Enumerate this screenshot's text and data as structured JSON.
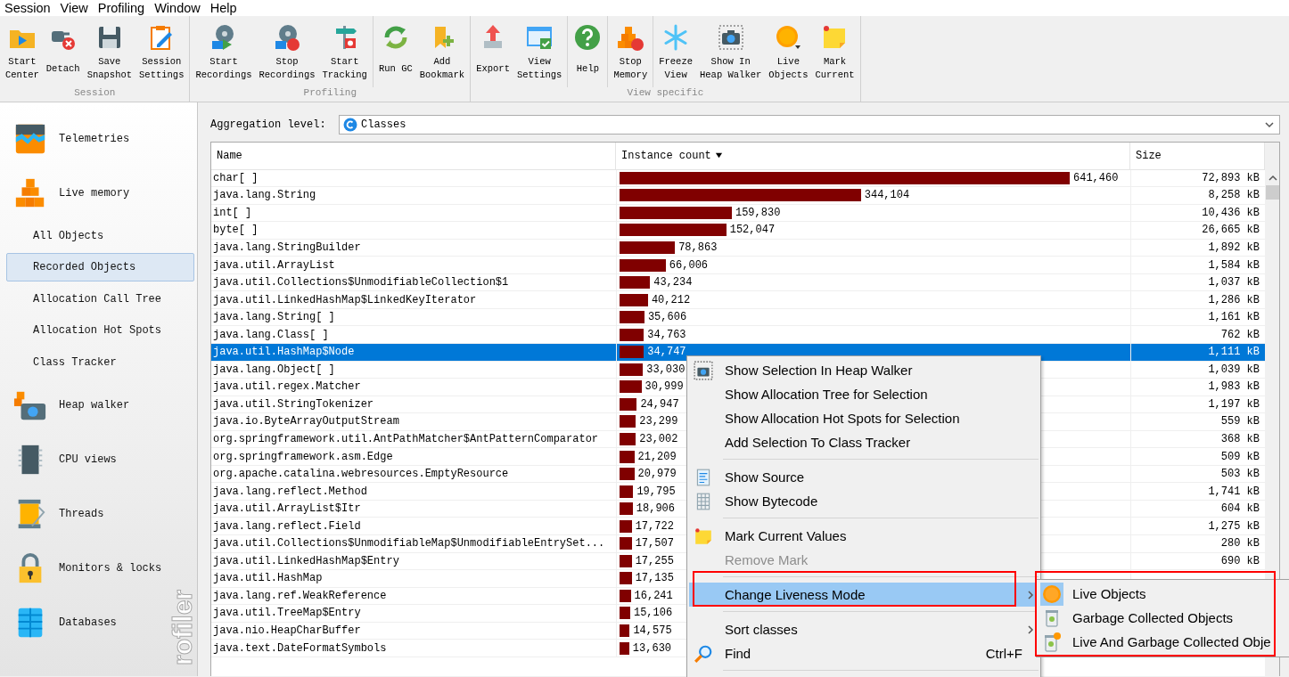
{
  "menubar": [
    "Session",
    "View",
    "Profiling",
    "Window",
    "Help"
  ],
  "toolbar": [
    {
      "label": "Session",
      "sections": [
        [
          "Start\nCenter",
          "Detach",
          "Save\nSnapshot",
          "Session\nSettings"
        ]
      ]
    },
    {
      "label": "Profiling",
      "sections": [
        [
          "Start\nRecordings",
          "Stop\nRecordings",
          "Start\nTracking"
        ],
        [
          "Run GC",
          "Add\nBookmark"
        ]
      ]
    },
    {
      "label": "View specific",
      "sections": [
        [
          "Export",
          "View\nSettings"
        ],
        [
          "Help"
        ],
        [
          "Stop\nMemory"
        ],
        [
          "Freeze\nView",
          "Show In\nHeap Walker",
          "Live\nObjects",
          "Mark\nCurrent"
        ]
      ]
    }
  ],
  "sidebar": {
    "watermark": "rofiler",
    "items": [
      {
        "label": "Telemetries",
        "selected": false
      },
      {
        "label": "Live memory",
        "selected": false,
        "children": [
          {
            "label": "All Objects",
            "selected": false
          },
          {
            "label": "Recorded Objects",
            "selected": true
          },
          {
            "label": "Allocation Call Tree",
            "selected": false
          },
          {
            "label": "Allocation Hot Spots",
            "selected": false
          },
          {
            "label": "Class Tracker",
            "selected": false
          }
        ]
      },
      {
        "label": "Heap walker",
        "selected": false
      },
      {
        "label": "CPU views",
        "selected": false
      },
      {
        "label": "Threads",
        "selected": false
      },
      {
        "label": "Monitors & locks",
        "selected": false
      },
      {
        "label": "Databases",
        "selected": false
      }
    ]
  },
  "aggregation": {
    "label": "Aggregation level:",
    "value": "Classes"
  },
  "table": {
    "columns": [
      {
        "label": "Name",
        "sorted": false
      },
      {
        "label": "Instance count",
        "sorted": true
      },
      {
        "label": "Size",
        "sorted": false
      }
    ],
    "rows": [
      {
        "name": "char[ ]",
        "count": "641,460",
        "level": 0.886,
        "size": "72,893 kB",
        "selected": false
      },
      {
        "name": "java.lang.String",
        "count": "344,104",
        "level": 0.475,
        "size": "8,258 kB",
        "selected": false
      },
      {
        "name": "int[ ]",
        "count": "159,830",
        "level": 0.221,
        "size": "10,436 kB",
        "selected": false
      },
      {
        "name": "byte[ ]",
        "count": "152,047",
        "level": 0.21,
        "size": "26,665 kB",
        "selected": false
      },
      {
        "name": "java.lang.StringBuilder",
        "count": "78,863",
        "level": 0.109,
        "size": "1,892 kB",
        "selected": false
      },
      {
        "name": "java.util.ArrayList",
        "count": "66,006",
        "level": 0.091,
        "size": "1,584 kB",
        "selected": false
      },
      {
        "name": "java.util.Collections$UnmodifiableCollection$1",
        "count": "43,234",
        "level": 0.06,
        "size": "1,037 kB",
        "selected": false
      },
      {
        "name": "java.util.LinkedHashMap$LinkedKeyIterator",
        "count": "40,212",
        "level": 0.056,
        "size": "1,286 kB",
        "selected": false
      },
      {
        "name": "java.lang.String[ ]",
        "count": "35,606",
        "level": 0.049,
        "size": "1,161 kB",
        "selected": false
      },
      {
        "name": "java.lang.Class[ ]",
        "count": "34,763",
        "level": 0.048,
        "size": "762 kB",
        "selected": false
      },
      {
        "name": "java.util.HashMap$Node",
        "count": "34,747",
        "level": 0.048,
        "size": "1,111 kB",
        "selected": true
      },
      {
        "name": "java.lang.Object[ ]",
        "count": "33,030",
        "level": 0.046,
        "size": "1,039 kB",
        "selected": false
      },
      {
        "name": "java.util.regex.Matcher",
        "count": "30,999",
        "level": 0.043,
        "size": "1,983 kB",
        "selected": false
      },
      {
        "name": "java.util.StringTokenizer",
        "count": "24,947",
        "level": 0.034,
        "size": "1,197 kB",
        "selected": false
      },
      {
        "name": "java.io.ByteArrayOutputStream",
        "count": "23,299",
        "level": 0.032,
        "size": "559 kB",
        "selected": false
      },
      {
        "name": "org.springframework.util.AntPathMatcher$AntPatternComparator",
        "count": "23,002",
        "level": 0.032,
        "size": "368 kB",
        "selected": false
      },
      {
        "name": "org.springframework.asm.Edge",
        "count": "21,209",
        "level": 0.029,
        "size": "509 kB",
        "selected": false
      },
      {
        "name": "org.apache.catalina.webresources.EmptyResource",
        "count": "20,979",
        "level": 0.029,
        "size": "503 kB",
        "selected": false
      },
      {
        "name": "java.lang.reflect.Method",
        "count": "19,795",
        "level": 0.027,
        "size": "1,741 kB",
        "selected": false
      },
      {
        "name": "java.util.ArrayList$Itr",
        "count": "18,906",
        "level": 0.026,
        "size": "604 kB",
        "selected": false
      },
      {
        "name": "java.lang.reflect.Field",
        "count": "17,722",
        "level": 0.024,
        "size": "1,275 kB",
        "selected": false
      },
      {
        "name": "java.util.Collections$UnmodifiableMap$UnmodifiableEntrySet...",
        "count": "17,507",
        "level": 0.024,
        "size": "280 kB",
        "selected": false
      },
      {
        "name": "java.util.LinkedHashMap$Entry",
        "count": "17,255",
        "level": 0.024,
        "size": "690 kB",
        "selected": false
      },
      {
        "name": "java.util.HashMap",
        "count": "17,135",
        "level": 0.024,
        "selected": false
      },
      {
        "name": "java.lang.ref.WeakReference",
        "count": "16,241",
        "level": 0.022,
        "selected": false
      },
      {
        "name": "java.util.TreeMap$Entry",
        "count": "15,106",
        "level": 0.021,
        "selected": false
      },
      {
        "name": "java.nio.HeapCharBuffer",
        "count": "14,575",
        "level": 0.02,
        "selected": false
      },
      {
        "name": "java.text.DateFormatSymbols",
        "count": "13,630",
        "level": 0.019,
        "selected": false
      }
    ]
  },
  "context_menu": {
    "items": [
      {
        "kind": "item",
        "label": "Show Selection In Heap Walker",
        "disabled": false,
        "highlighted": false
      },
      {
        "kind": "item",
        "label": "Show Allocation Tree for Selection",
        "disabled": false,
        "highlighted": false
      },
      {
        "kind": "item",
        "label": "Show Allocation Hot Spots for Selection",
        "disabled": false,
        "highlighted": false
      },
      {
        "kind": "item",
        "label": "Add Selection To Class Tracker",
        "disabled": false,
        "highlighted": false
      },
      {
        "kind": "separator"
      },
      {
        "kind": "item",
        "label": "Show Source",
        "disabled": false,
        "highlighted": false
      },
      {
        "kind": "item",
        "label": "Show Bytecode",
        "disabled": false,
        "highlighted": false
      },
      {
        "kind": "separator"
      },
      {
        "kind": "item",
        "label": "Mark Current Values",
        "disabled": false,
        "highlighted": false
      },
      {
        "kind": "item",
        "label": "Remove Mark",
        "disabled": true,
        "highlighted": false
      },
      {
        "kind": "separator"
      },
      {
        "kind": "submenu",
        "label": "Change Liveness Mode",
        "disabled": false,
        "highlighted": true,
        "annotated": true
      },
      {
        "kind": "separator"
      },
      {
        "kind": "submenu",
        "label": "Sort classes",
        "disabled": false,
        "highlighted": false
      },
      {
        "kind": "item",
        "label": "Find",
        "shortcut": "Ctrl+F",
        "disabled": false,
        "highlighted": false
      },
      {
        "kind": "separator"
      }
    ]
  },
  "submenu": {
    "annotated": true,
    "items": [
      {
        "label": "Live Objects",
        "selected": true
      },
      {
        "label": "Garbage Collected Objects",
        "selected": false
      },
      {
        "label": "Live And Garbage Collected Obje",
        "selected": false
      }
    ]
  }
}
